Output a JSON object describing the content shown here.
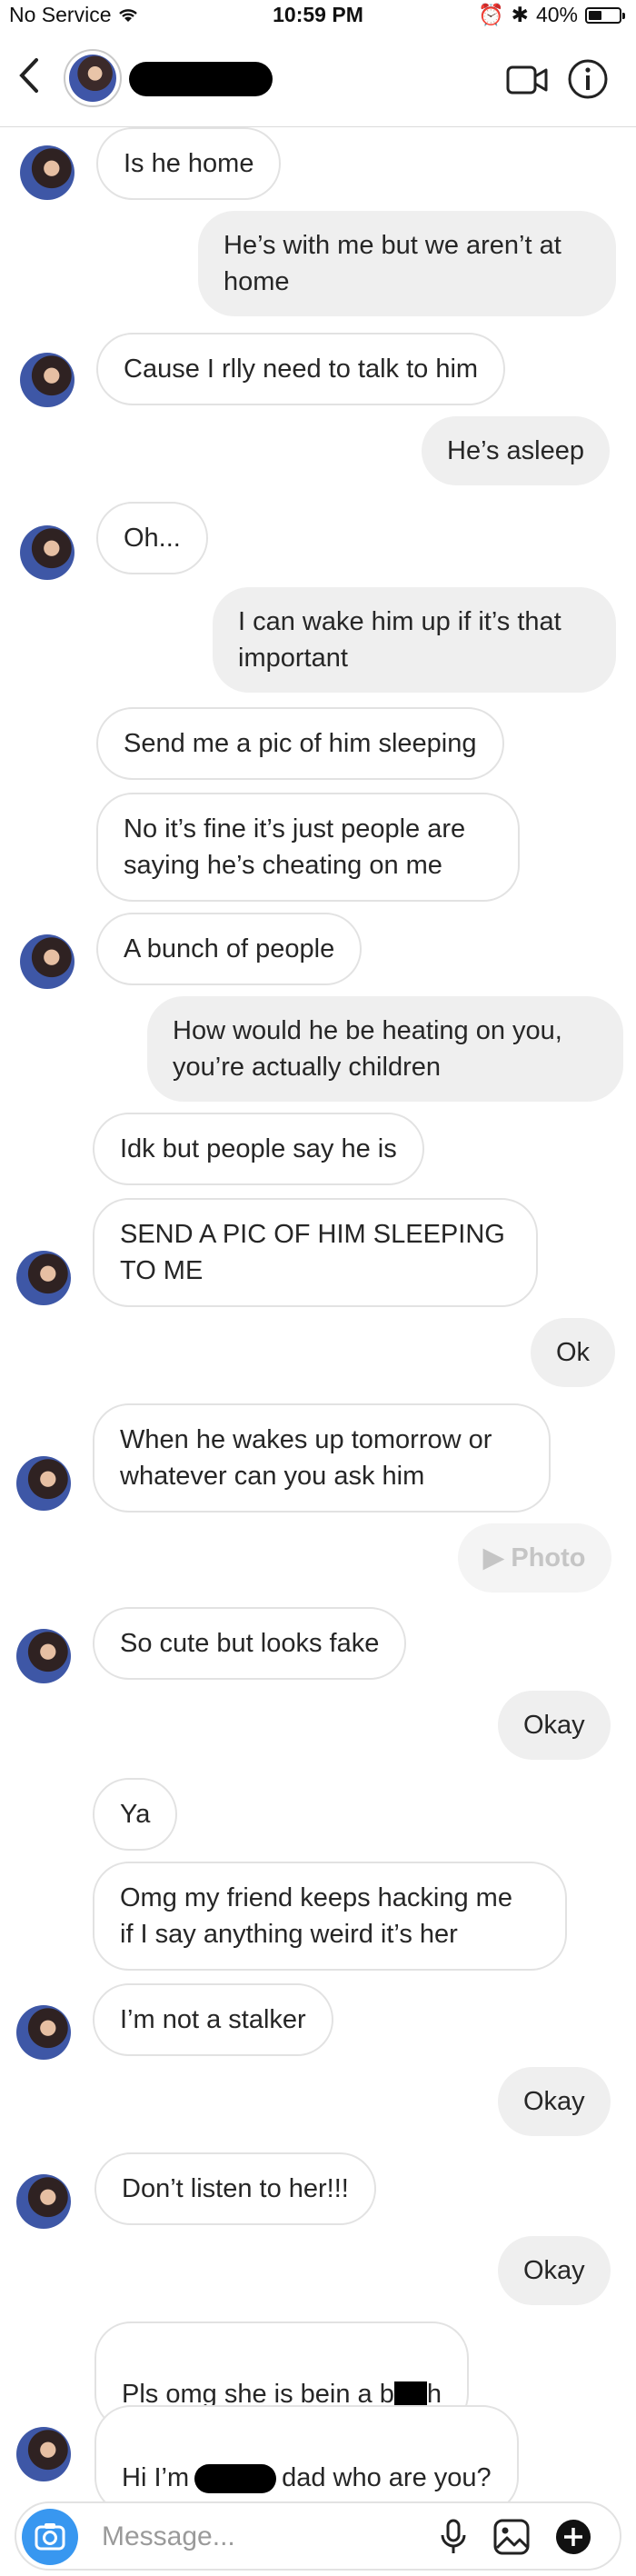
{
  "status": {
    "carrier": "No Service",
    "time": "10:59 PM",
    "battery": "40%",
    "battery_level": 0.4
  },
  "header": {
    "back_icon": "chevron-left-icon"
  },
  "messages": [
    {
      "side": "in",
      "text": "Is he home"
    },
    {
      "side": "out",
      "text": "He’s with me but we aren’t at\nhome"
    },
    {
      "side": "in",
      "text": "Cause I rlly need to talk to him"
    },
    {
      "side": "out",
      "text": "He’s asleep"
    },
    {
      "side": "in",
      "text": "Oh..."
    },
    {
      "side": "out",
      "text": "I can wake him up if it’s that\nimportant"
    },
    {
      "side": "in",
      "text": "Send me a pic of him sleeping"
    },
    {
      "side": "in",
      "text": "No it’s fine it’s just people are\nsaying he’s cheating on me"
    },
    {
      "side": "in",
      "text": "A bunch of people"
    },
    {
      "side": "out",
      "text": "How would he be heating on you,\nyou’re actually children"
    },
    {
      "side": "in",
      "text": "Idk but people say he is"
    },
    {
      "side": "in",
      "text": "SEND A PIC OF HIM SLEEPING\nTO ME"
    },
    {
      "side": "out",
      "text": "Ok"
    },
    {
      "side": "in",
      "text": "When he wakes up tomorrow or\nwhatever can you ask him"
    },
    {
      "side": "out",
      "text": "▶ Photo"
    },
    {
      "side": "in",
      "text": "So cute but looks fake"
    },
    {
      "side": "out",
      "text": "Okay"
    },
    {
      "side": "in",
      "text": "Ya"
    },
    {
      "side": "in",
      "text": "Omg my friend keeps hacking me\nif I say anything weird it’s her"
    },
    {
      "side": "in",
      "text": "I’m not a stalker"
    },
    {
      "side": "out",
      "text": "Okay"
    },
    {
      "side": "in",
      "text": "Don’t listen to her!!!"
    },
    {
      "side": "out",
      "text": "Okay"
    },
    {
      "side": "in",
      "text_before": "Pls omg she is bein a b",
      "text_after": "h"
    },
    {
      "side": "in",
      "text_before": "Hi I’m",
      "text_after": "dad who are you?"
    }
  ],
  "composer": {
    "placeholder": "Message..."
  }
}
